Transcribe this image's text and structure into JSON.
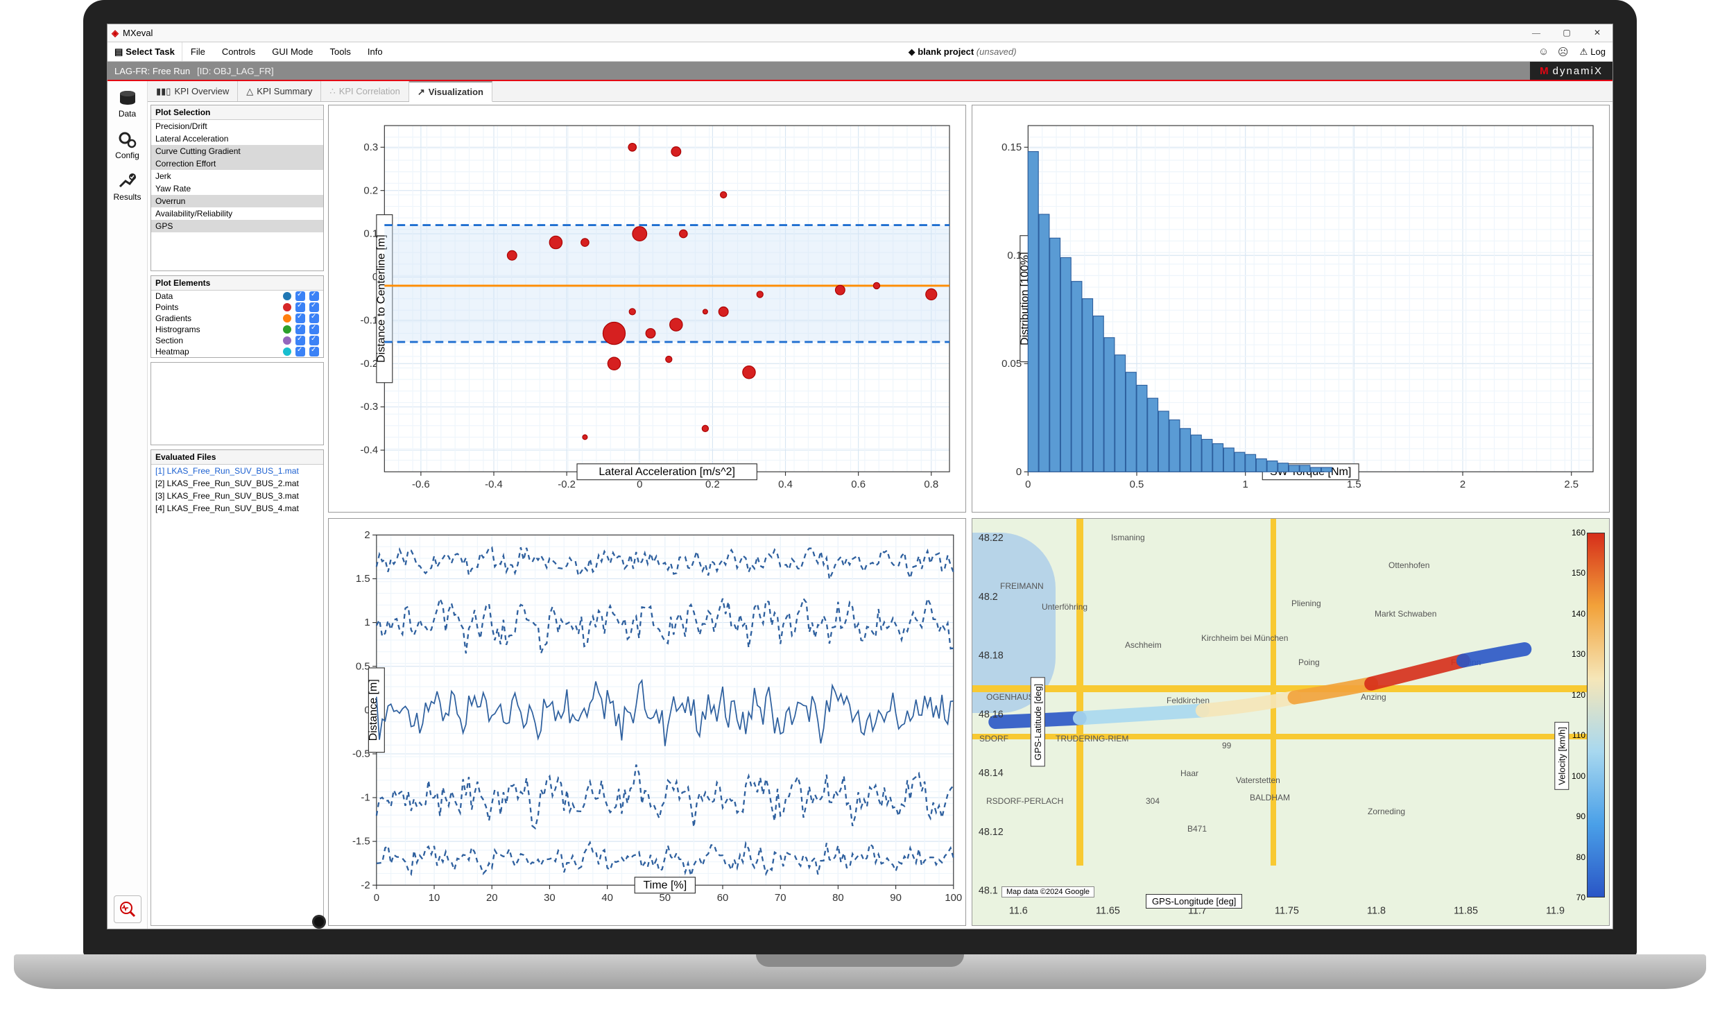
{
  "titlebar": {
    "app": "MXeval"
  },
  "menubar": {
    "select_task": "Select Task",
    "items": [
      "File",
      "Controls",
      "GUI Mode",
      "Tools",
      "Info"
    ],
    "project_prefix": "blank project",
    "project_state": "(unsaved)",
    "log": "Log"
  },
  "ribbon": {
    "task": "LAG-FR: Free Run",
    "id": "[ID: OBJ_LAG_FR]",
    "brand": "dynamiX"
  },
  "left_nav": [
    {
      "id": "data",
      "label": "Data"
    },
    {
      "id": "config",
      "label": "Config"
    },
    {
      "id": "results",
      "label": "Results"
    }
  ],
  "tabs": [
    {
      "id": "kpi-overview",
      "label": "KPI Overview",
      "active": false
    },
    {
      "id": "kpi-summary",
      "label": "KPI Summary",
      "active": false
    },
    {
      "id": "kpi-correlation",
      "label": "KPI Correlation",
      "active": false,
      "disabled": true
    },
    {
      "id": "visualization",
      "label": "Visualization",
      "active": true
    }
  ],
  "plot_selection": {
    "header": "Plot Selection",
    "items": [
      {
        "label": "Precision/Drift",
        "sel": false
      },
      {
        "label": "Lateral Acceleration",
        "sel": false
      },
      {
        "label": "Curve Cutting Gradient",
        "sel": true
      },
      {
        "label": "Correction Effort",
        "sel": true
      },
      {
        "label": "Jerk",
        "sel": false
      },
      {
        "label": "Yaw Rate",
        "sel": false
      },
      {
        "label": "Overrun",
        "sel": true
      },
      {
        "label": "Availability/Reliability",
        "sel": false
      },
      {
        "label": "GPS",
        "sel": true
      }
    ]
  },
  "plot_elements": {
    "header": "Plot Elements",
    "items": [
      {
        "label": "Data",
        "color": "#1f77b4"
      },
      {
        "label": "Points",
        "color": "#d62728"
      },
      {
        "label": "Gradients",
        "color": "#ff7f0e"
      },
      {
        "label": "Histrograms",
        "color": "#2ca02c"
      },
      {
        "label": "Section",
        "color": "#9467bd"
      },
      {
        "label": "Heatmap",
        "color": "#17becf"
      }
    ]
  },
  "evaluated_files": {
    "header": "Evaluated Files",
    "items": [
      {
        "label": "[1] LKAS_Free_Run_SUV_BUS_1.mat",
        "sel": true
      },
      {
        "label": "[2] LKAS_Free_Run_SUV_BUS_2.mat",
        "sel": false
      },
      {
        "label": "[3] LKAS_Free_Run_SUV_BUS_3.mat",
        "sel": false
      },
      {
        "label": "[4] LKAS_Free_Run_SUV_BUS_4.mat",
        "sel": false
      }
    ]
  },
  "charts": {
    "scatter": {
      "xlabel": "Lateral Acceleration [m/s^2]",
      "ylabel": "Distance to Centerline [m]",
      "xticks": [
        -0.6,
        -0.4,
        -0.2,
        0,
        0.2,
        0.4,
        0.6,
        0.8
      ],
      "yticks": [
        -0.4,
        -0.3,
        -0.2,
        -0.1,
        0,
        0.1,
        0.2,
        0.3
      ]
    },
    "hist": {
      "xlabel": "SW Torque [Nm]",
      "ylabel": "Distribution [100%]",
      "xticks": [
        0,
        0.5,
        1,
        1.5,
        2,
        2.5
      ],
      "yticks": [
        0,
        0.05,
        0.1,
        0.15
      ]
    },
    "time": {
      "xlabel": "Time [%]",
      "ylabel": "Distance [m]",
      "xticks": [
        0,
        10,
        20,
        30,
        40,
        50,
        60,
        70,
        80,
        90,
        100
      ],
      "yticks": [
        -2,
        -1.5,
        -1,
        -0.5,
        0,
        0.5,
        1,
        1.5,
        2
      ]
    },
    "map": {
      "xlabel": "GPS-Longitude [deg]",
      "ylabel": "GPS-Latitude [deg]",
      "xticks": [
        11.6,
        11.65,
        11.7,
        11.75,
        11.8,
        11.85,
        11.9
      ],
      "yticks": [
        48.1,
        48.12,
        48.14,
        48.16,
        48.18,
        48.2,
        48.22
      ],
      "attribution": "Map data ©2024 Google",
      "cities": [
        "Ismaning",
        "Unterföhring",
        "Aschheim",
        "Kirchheim bei München",
        "Feldkirchen",
        "TRUDERING-RIEM",
        "Haar",
        "Vaterstetten",
        "Poing",
        "Anzing",
        "Pliening",
        "Markt Schwaben",
        "Ottenhofen",
        "Forstinn",
        "OGENHAUSEN",
        "BALDHAM",
        "B471",
        "FREIMANN",
        "RSDORF-PERLACH",
        "Zorneding",
        "SDORF",
        "99",
        "304"
      ],
      "colorbar_label": "Velocity [km/h]",
      "colorbar_ticks": [
        70,
        80,
        90,
        100,
        110,
        120,
        130,
        140,
        150,
        160
      ]
    }
  },
  "chart_data": [
    {
      "type": "scatter",
      "title": "",
      "xlabel": "Lateral Acceleration [m/s^2]",
      "ylabel": "Distance to Centerline [m]",
      "xlim": [
        -0.7,
        0.85
      ],
      "ylim": [
        -0.45,
        0.35
      ],
      "reference_line_y": -0.02,
      "upper_bound_y": 0.12,
      "lower_bound_y": -0.15,
      "points": [
        {
          "x": -0.35,
          "y": 0.05,
          "r": 6
        },
        {
          "x": -0.23,
          "y": 0.08,
          "r": 8
        },
        {
          "x": -0.15,
          "y": 0.08,
          "r": 5
        },
        {
          "x": -0.07,
          "y": -0.13,
          "r": 14
        },
        {
          "x": -0.07,
          "y": -0.2,
          "r": 8
        },
        {
          "x": -0.02,
          "y": 0.3,
          "r": 5
        },
        {
          "x": -0.02,
          "y": -0.08,
          "r": 4
        },
        {
          "x": 0.0,
          "y": 0.1,
          "r": 9
        },
        {
          "x": 0.03,
          "y": -0.13,
          "r": 6
        },
        {
          "x": 0.08,
          "y": -0.19,
          "r": 4
        },
        {
          "x": 0.1,
          "y": 0.29,
          "r": 6
        },
        {
          "x": 0.1,
          "y": -0.11,
          "r": 8
        },
        {
          "x": 0.12,
          "y": 0.1,
          "r": 5
        },
        {
          "x": 0.18,
          "y": -0.08,
          "r": 3
        },
        {
          "x": 0.18,
          "y": -0.35,
          "r": 4
        },
        {
          "x": 0.23,
          "y": -0.08,
          "r": 6
        },
        {
          "x": 0.23,
          "y": 0.19,
          "r": 4
        },
        {
          "x": 0.3,
          "y": -0.22,
          "r": 8
        },
        {
          "x": 0.33,
          "y": -0.04,
          "r": 4
        },
        {
          "x": 0.55,
          "y": -0.03,
          "r": 6
        },
        {
          "x": 0.65,
          "y": -0.02,
          "r": 4
        },
        {
          "x": 0.8,
          "y": -0.04,
          "r": 7
        },
        {
          "x": -0.15,
          "y": -0.37,
          "r": 3
        }
      ]
    },
    {
      "type": "bar",
      "title": "",
      "xlabel": "SW Torque [Nm]",
      "ylabel": "Distribution [100%]",
      "xlim": [
        0,
        2.6
      ],
      "ylim": [
        0,
        0.16
      ],
      "bin_width": 0.05,
      "categories": [
        0.025,
        0.075,
        0.125,
        0.175,
        0.225,
        0.275,
        0.325,
        0.375,
        0.425,
        0.475,
        0.525,
        0.575,
        0.625,
        0.675,
        0.725,
        0.775,
        0.825,
        0.875,
        0.925,
        0.975,
        1.025,
        1.075,
        1.125,
        1.175,
        1.225,
        1.275,
        1.325,
        1.375
      ],
      "values": [
        0.148,
        0.119,
        0.108,
        0.099,
        0.088,
        0.08,
        0.072,
        0.062,
        0.054,
        0.046,
        0.04,
        0.034,
        0.028,
        0.024,
        0.02,
        0.017,
        0.015,
        0.013,
        0.011,
        0.009,
        0.008,
        0.006,
        0.005,
        0.004,
        0.003,
        0.003,
        0.002,
        0.002
      ]
    },
    {
      "type": "line",
      "title": "",
      "xlabel": "Time [%]",
      "ylabel": "Distance [m]",
      "xlim": [
        0,
        100
      ],
      "ylim": [
        -2,
        2
      ],
      "series": [
        {
          "name": "upper-outer",
          "style": "dashed",
          "mean": 1.7,
          "amp": 0.2
        },
        {
          "name": "upper-inner",
          "style": "dashed",
          "mean": 1.0,
          "amp": 0.35
        },
        {
          "name": "center",
          "style": "solid",
          "mean": 0.0,
          "amp": 0.4
        },
        {
          "name": "lower-inner",
          "style": "dashed",
          "mean": -1.0,
          "amp": 0.35
        },
        {
          "name": "lower-outer",
          "style": "dashed",
          "mean": -1.7,
          "amp": 0.2
        }
      ]
    },
    {
      "type": "heatmap",
      "title": "",
      "xlabel": "GPS-Longitude [deg]",
      "ylabel": "GPS-Latitude [deg]",
      "xlim": [
        11.57,
        11.93
      ],
      "ylim": [
        48.09,
        48.23
      ],
      "colorbar": {
        "label": "Velocity [km/h]",
        "min": 65,
        "max": 165
      }
    }
  ]
}
